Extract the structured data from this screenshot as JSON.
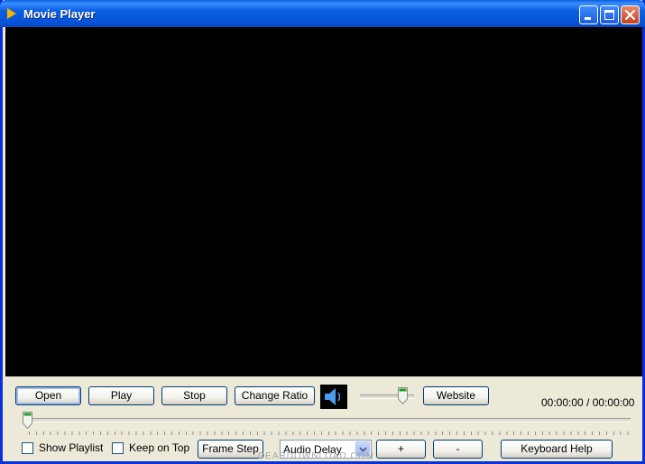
{
  "window": {
    "title": "Movie Player",
    "icons": {
      "app": "play-triangle-icon",
      "minimize": "minimize-icon",
      "maximize": "maximize-icon",
      "close": "close-icon"
    }
  },
  "controls": {
    "open": "Open",
    "play": "Play",
    "stop": "Stop",
    "change_ratio": "Change Ratio",
    "speaker_icon": "speaker-icon",
    "volume_level": 0.85,
    "website": "Website",
    "time_current": "00:00:00",
    "time_separator": "/",
    "time_total": "00:00:00",
    "seek_position": 0.0
  },
  "bottom": {
    "show_playlist": "Show Playlist",
    "keep_on_top": "Keep on Top",
    "frame_step": "Frame Step",
    "audio_delay": "Audio Delay",
    "plus": "+",
    "minus": "-",
    "keyboard_help": "Keyboard Help"
  },
  "watermark": "DEARDOWNLOAD.COM",
  "colors": {
    "titlebar": "#0B5FE3",
    "video_bg": "#000000",
    "face": "#ECE9D8",
    "speaker": "#4A9DF0"
  }
}
